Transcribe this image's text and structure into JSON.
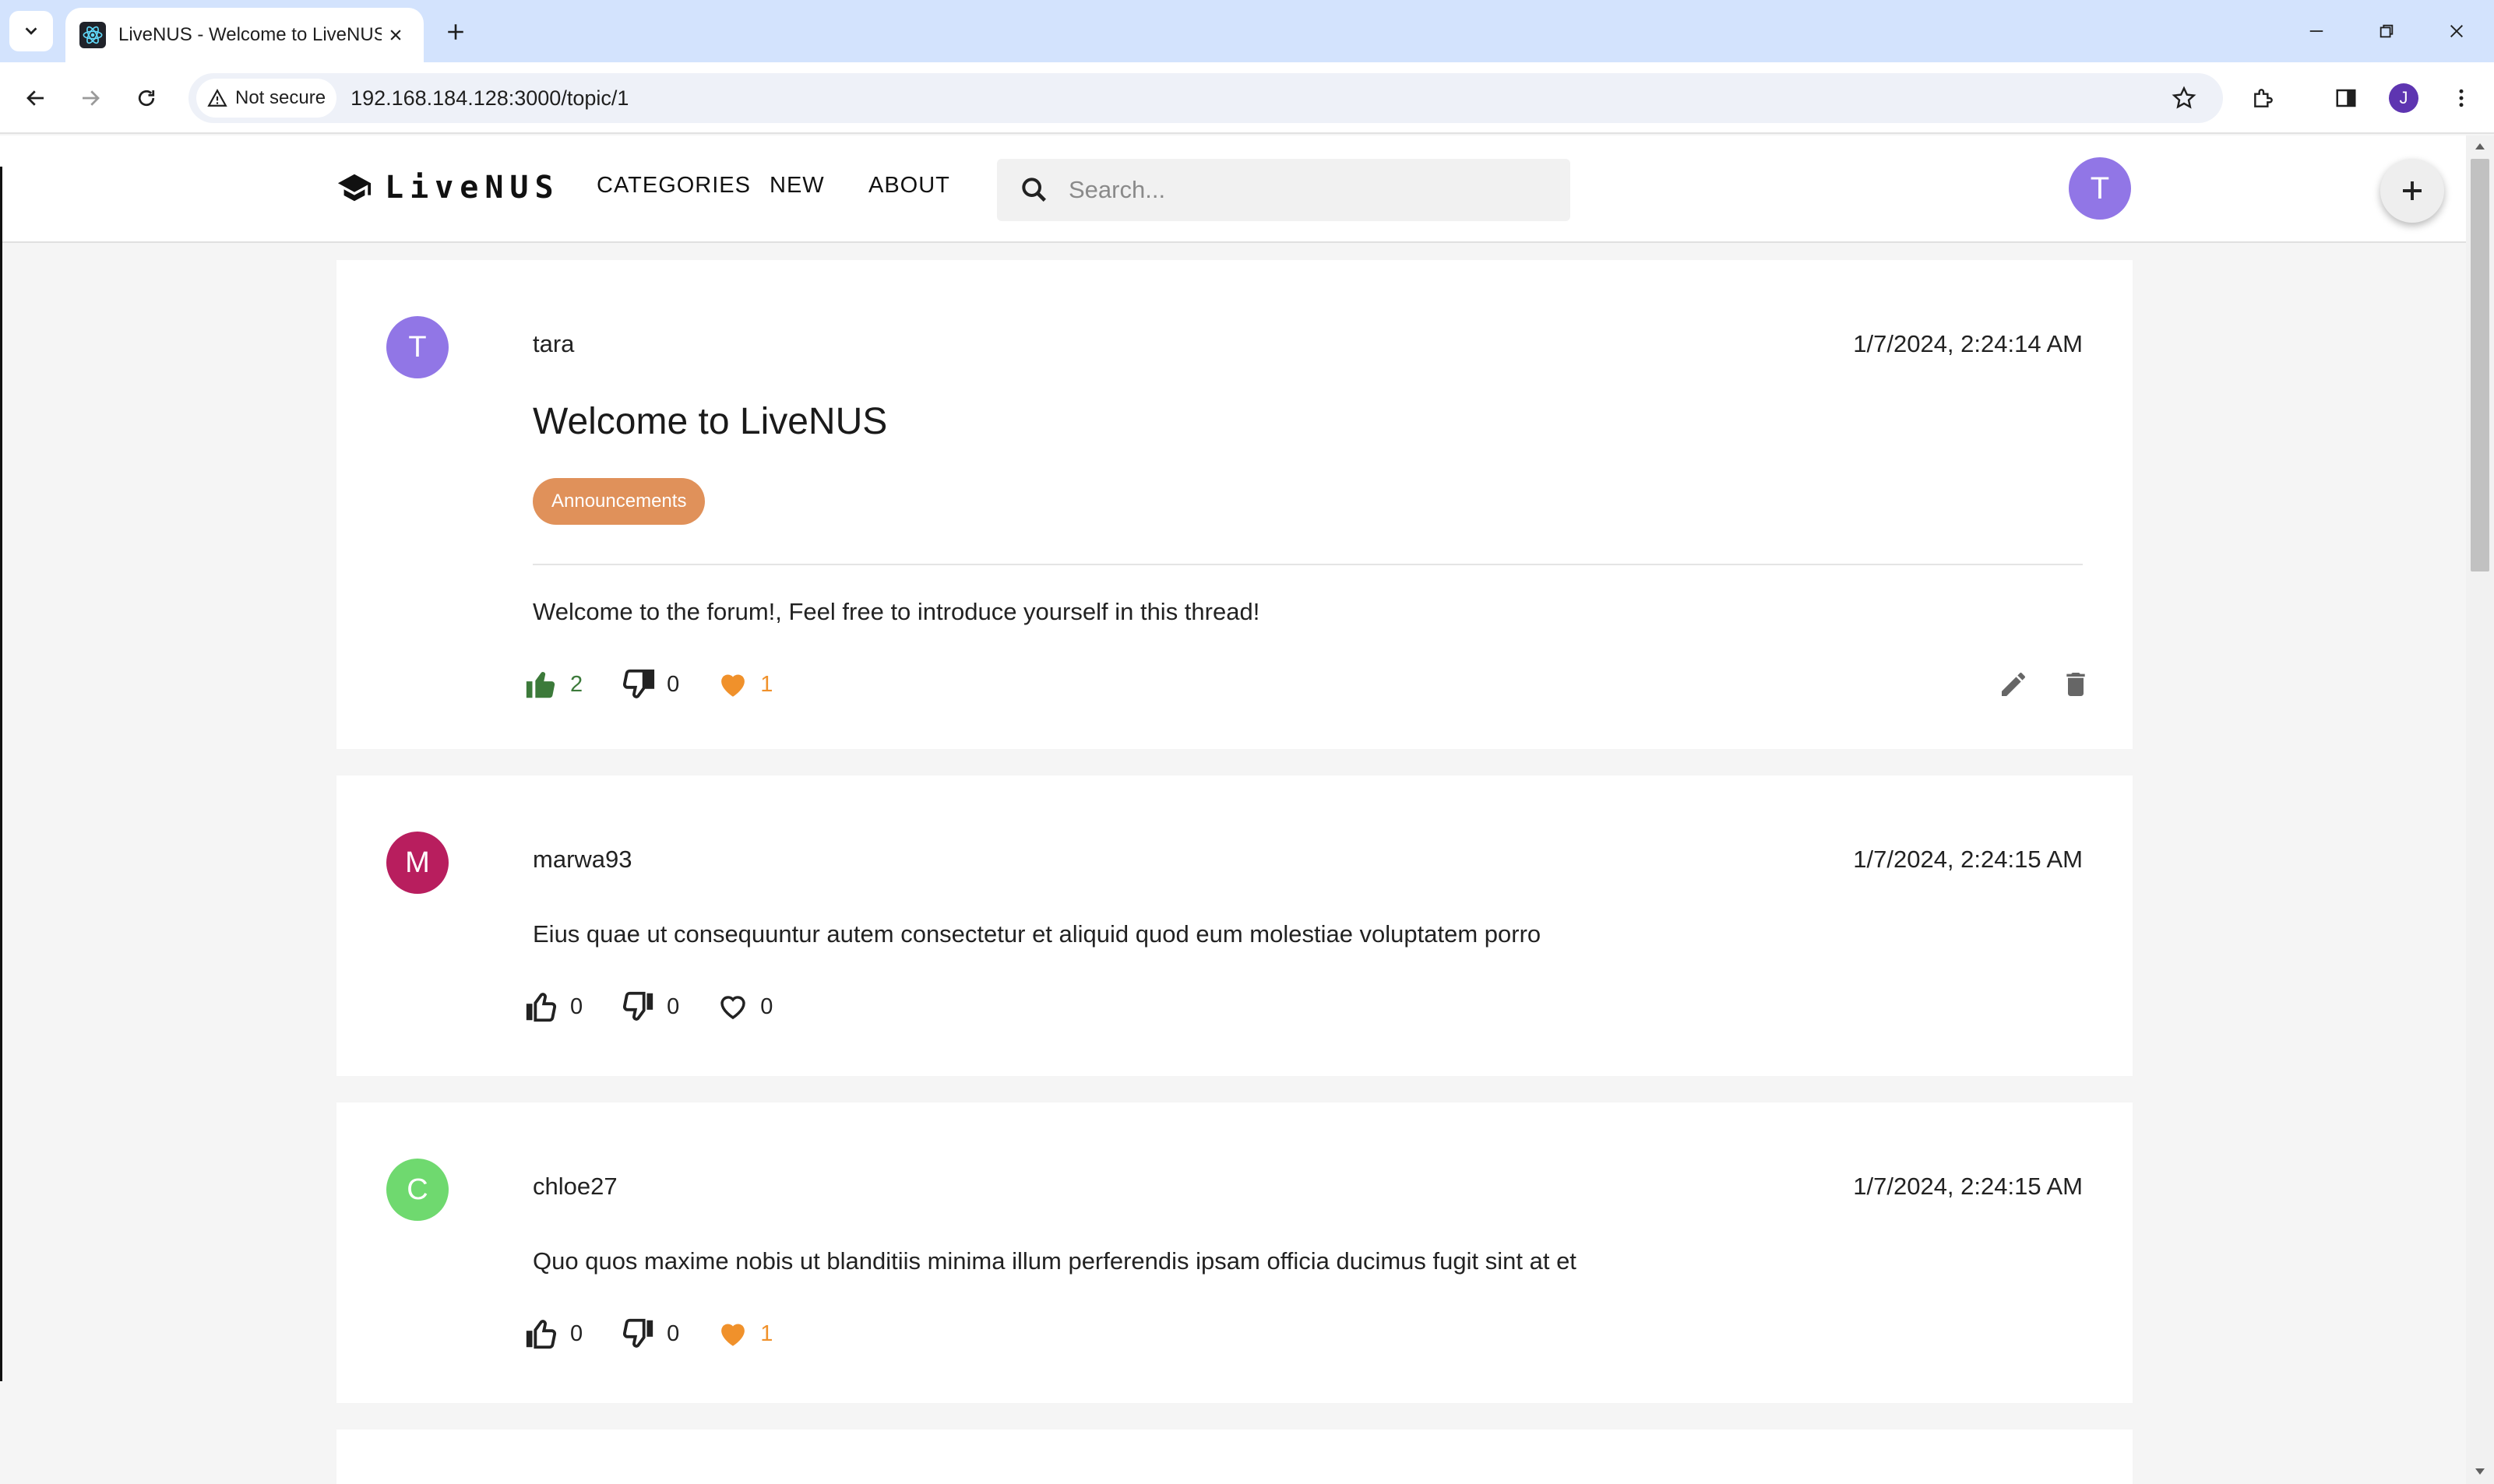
{
  "browser": {
    "tab_title": "LiveNUS - Welcome to LiveNUS",
    "security_label": "Not secure",
    "url": "192.168.184.128:3000/topic/1",
    "profile_initial": "J"
  },
  "header": {
    "logo_text": "LiveNUS",
    "nav": {
      "categories": "CATEGORIES",
      "new": "NEW",
      "about": "ABOUT"
    },
    "search_placeholder": "Search...",
    "user_initial": "T"
  },
  "colors": {
    "thumb_active": "#3c7a3a",
    "heart_active": "#f0912b",
    "chip": "#e0915a"
  },
  "posts": [
    {
      "avatar_initial": "T",
      "avatar_color": "#9176e6",
      "username": "tara",
      "timestamp": "1/7/2024, 2:24:14 AM",
      "title": "Welcome to LiveNUS",
      "category": "Announcements",
      "body": "Welcome to the forum!, Feel free to introduce yourself in this thread!",
      "likes": "2",
      "dislikes": "0",
      "hearts": "1"
    },
    {
      "avatar_initial": "M",
      "avatar_color": "#b81e5e",
      "username": "marwa93",
      "timestamp": "1/7/2024, 2:24:15 AM",
      "body": "Eius quae ut consequuntur autem consectetur et aliquid quod eum molestiae voluptatem porro",
      "likes": "0",
      "dislikes": "0",
      "hearts": "0"
    },
    {
      "avatar_initial": "C",
      "avatar_color": "#6fd96f",
      "username": "chloe27",
      "timestamp": "1/7/2024, 2:24:15 AM",
      "body": "Quo quos maxime nobis ut blanditiis minima illum perferendis ipsam officia ducimus fugit sint at et",
      "likes": "0",
      "dislikes": "0",
      "hearts": "1"
    }
  ]
}
